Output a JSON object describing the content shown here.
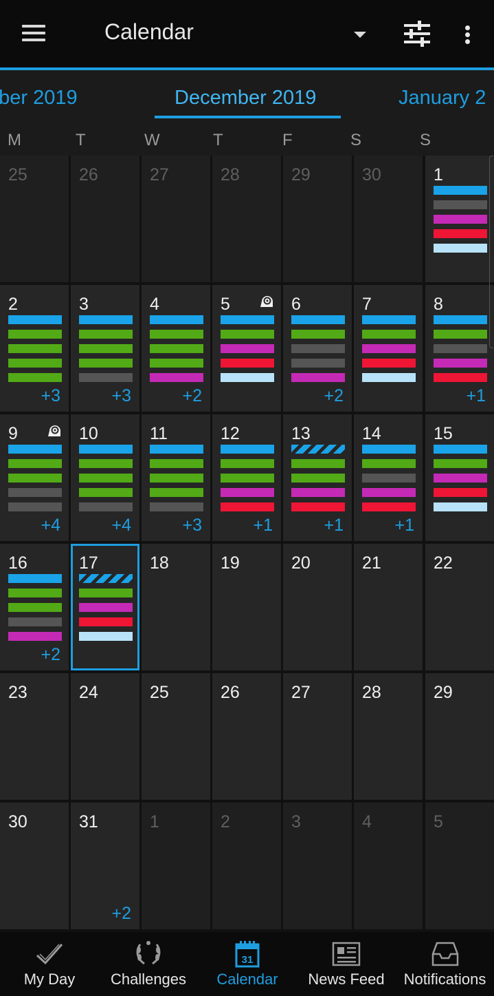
{
  "appbar": {
    "title": "Calendar"
  },
  "months": {
    "prev": "mber 2019",
    "current": "December 2019",
    "next": "January 2"
  },
  "weekdays": [
    "M",
    "T",
    "W",
    "T",
    "F",
    "S",
    "S"
  ],
  "colors": {
    "accent": "#1e9ee0",
    "blue": "#1aa3e8",
    "green": "#52aa16",
    "gray": "#555555",
    "magenta": "#c42ab5",
    "red": "#ee1535",
    "light_blue": "#b8e2f8"
  },
  "weeks": [
    [
      {
        "day": "25",
        "dim": true,
        "bars": [],
        "more": ""
      },
      {
        "day": "26",
        "dim": true,
        "bars": [],
        "more": ""
      },
      {
        "day": "27",
        "dim": true,
        "bars": [],
        "more": ""
      },
      {
        "day": "28",
        "dim": true,
        "bars": [],
        "more": ""
      },
      {
        "day": "29",
        "dim": true,
        "bars": [],
        "more": ""
      },
      {
        "day": "30",
        "dim": true,
        "bars": [],
        "more": ""
      },
      {
        "day": "1",
        "bars": [
          "blue",
          "gray",
          "mag",
          "red",
          "lite"
        ],
        "more": ""
      }
    ],
    [
      {
        "day": "2",
        "bars": [
          "blue",
          "green",
          "green",
          "green",
          "green"
        ],
        "more": "+3"
      },
      {
        "day": "3",
        "bars": [
          "blue",
          "green",
          "green",
          "green",
          "gray"
        ],
        "more": "+3"
      },
      {
        "day": "4",
        "bars": [
          "blue",
          "green",
          "green",
          "green",
          "mag"
        ],
        "more": "+2"
      },
      {
        "day": "5",
        "snail": true,
        "bars": [
          "blue",
          "green",
          "mag",
          "red",
          "lite"
        ],
        "more": ""
      },
      {
        "day": "6",
        "bars": [
          "blue",
          "green",
          "gray",
          "gray",
          "mag"
        ],
        "more": "+2"
      },
      {
        "day": "7",
        "bars": [
          "blue",
          "green",
          "mag",
          "red",
          "lite"
        ],
        "more": ""
      },
      {
        "day": "8",
        "bars": [
          "blue",
          "green",
          "gray",
          "mag",
          "red"
        ],
        "more": "+1"
      }
    ],
    [
      {
        "day": "9",
        "snail": true,
        "bars": [
          "blue",
          "green",
          "green",
          "gray",
          "gray"
        ],
        "more": "+4"
      },
      {
        "day": "10",
        "bars": [
          "blue",
          "green",
          "green",
          "green",
          "gray"
        ],
        "more": "+4"
      },
      {
        "day": "11",
        "bars": [
          "blue",
          "green",
          "green",
          "green",
          "gray"
        ],
        "more": "+3"
      },
      {
        "day": "12",
        "bars": [
          "blue",
          "green",
          "green",
          "mag",
          "red"
        ],
        "more": "+1"
      },
      {
        "day": "13",
        "bars": [
          "stripe",
          "green",
          "green",
          "mag",
          "red"
        ],
        "more": "+1"
      },
      {
        "day": "14",
        "bars": [
          "blue",
          "green",
          "gray",
          "mag",
          "red"
        ],
        "more": "+1"
      },
      {
        "day": "15",
        "bars": [
          "blue",
          "green",
          "mag",
          "red",
          "lite"
        ],
        "more": ""
      }
    ],
    [
      {
        "day": "16",
        "bars": [
          "blue",
          "green",
          "green",
          "gray",
          "mag"
        ],
        "more": "+2"
      },
      {
        "day": "17",
        "today": true,
        "bars": [
          "stripe",
          "green",
          "mag",
          "red",
          "lite"
        ],
        "more": ""
      },
      {
        "day": "18",
        "bars": [],
        "more": ""
      },
      {
        "day": "19",
        "bars": [],
        "more": ""
      },
      {
        "day": "20",
        "bars": [],
        "more": ""
      },
      {
        "day": "21",
        "bars": [],
        "more": ""
      },
      {
        "day": "22",
        "bars": [],
        "more": ""
      }
    ],
    [
      {
        "day": "23",
        "bars": [],
        "more": ""
      },
      {
        "day": "24",
        "bars": [],
        "more": ""
      },
      {
        "day": "25",
        "bars": [],
        "more": ""
      },
      {
        "day": "26",
        "bars": [],
        "more": ""
      },
      {
        "day": "27",
        "bars": [],
        "more": ""
      },
      {
        "day": "28",
        "bars": [],
        "more": ""
      },
      {
        "day": "29",
        "bars": [],
        "more": ""
      }
    ],
    [
      {
        "day": "30",
        "bars": [],
        "more": ""
      },
      {
        "day": "31",
        "bars": [],
        "more": "+2"
      },
      {
        "day": "1",
        "dim": true,
        "bars": [],
        "more": ""
      },
      {
        "day": "2",
        "dim": true,
        "bars": [],
        "more": ""
      },
      {
        "day": "3",
        "dim": true,
        "bars": [],
        "more": ""
      },
      {
        "day": "4",
        "dim": true,
        "bars": [],
        "more": ""
      },
      {
        "day": "5",
        "dim": true,
        "bars": [],
        "more": ""
      }
    ]
  ],
  "nav": [
    {
      "label": "My Day",
      "icon": "checkmark-icon"
    },
    {
      "label": "Challenges",
      "icon": "laurel-icon"
    },
    {
      "label": "Calendar",
      "icon": "calendar-icon",
      "icon_text": "31",
      "active": true
    },
    {
      "label": "News Feed",
      "icon": "newspaper-icon"
    },
    {
      "label": "Notifications",
      "icon": "inbox-icon"
    }
  ]
}
